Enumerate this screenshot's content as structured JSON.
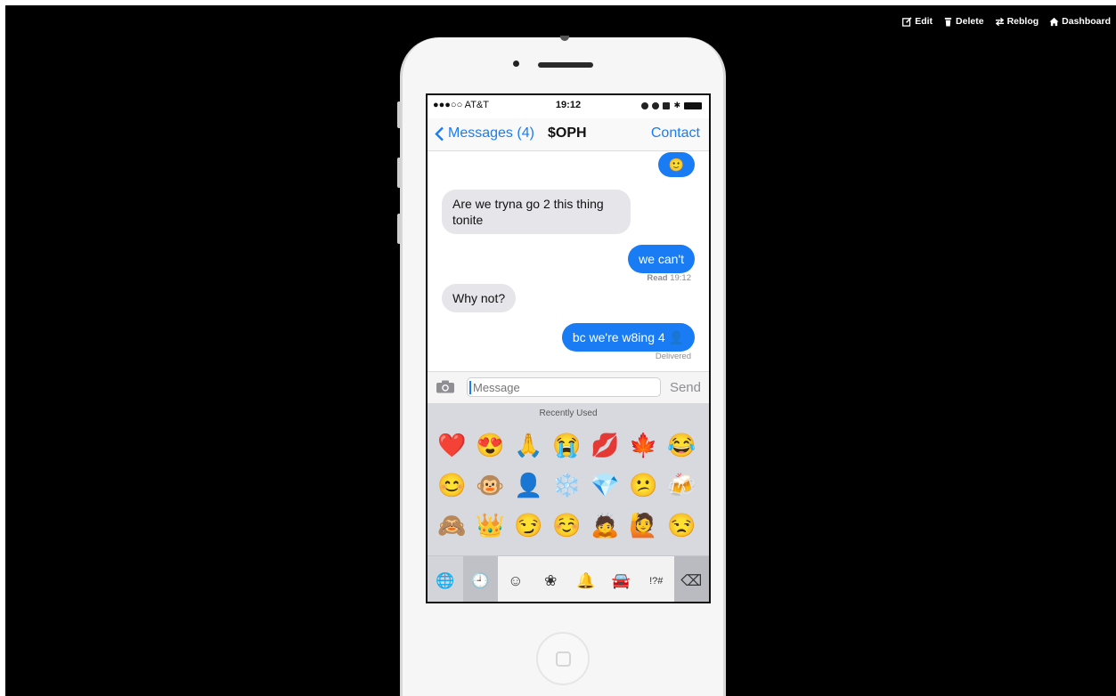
{
  "controls": {
    "edit": "Edit",
    "delete": "Delete",
    "reblog": "Reblog",
    "dashboard": "Dashboard"
  },
  "status_bar": {
    "carrier": "●●●○○ AT&T",
    "time": "19:12"
  },
  "nav": {
    "back_label": "Messages (4)",
    "title": "$OPH",
    "contact_label": "Contact"
  },
  "messages": {
    "m0": "🙂",
    "m1": "Are we tryna go 2 this thing tonite",
    "m2": "we can't",
    "m2_meta_bold": "Read",
    "m2_meta_time": "19:12",
    "m3": "Why not?",
    "m4": "bc we're w8ing 4 👤",
    "m4_meta": "Delivered"
  },
  "compose": {
    "placeholder": "Message",
    "send_label": "Send"
  },
  "keyboard": {
    "section_label": "Recently Used",
    "emojis": [
      "❤️",
      "😍",
      "🙏",
      "😭",
      "💋",
      "🍁",
      "😂",
      "😊",
      "🐵",
      "👤",
      "❄️",
      "💎",
      "😕",
      "🍻",
      "🙈",
      "👑",
      "😏",
      "☺️",
      "🙇",
      "🙋",
      "😒"
    ],
    "keys": {
      "globe": "🌐",
      "recent": "🕘",
      "smiley": "☺",
      "flower": "❀",
      "bell": "🔔",
      "car": "🚘",
      "symbols": "!?#",
      "delete": "⌫"
    }
  }
}
